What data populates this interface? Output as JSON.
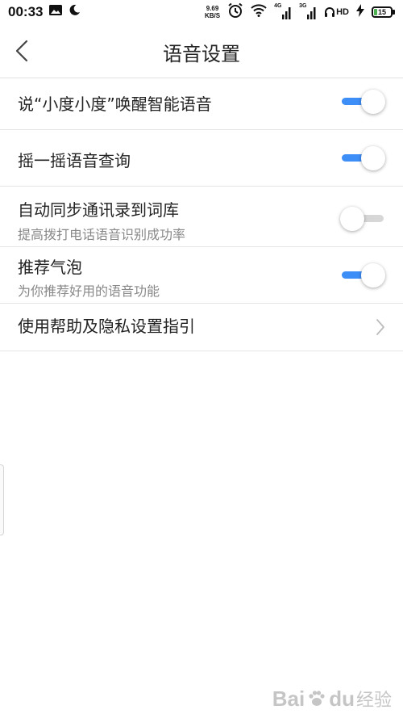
{
  "status_bar": {
    "time": "00:33",
    "net_speed_value": "9.69",
    "net_speed_unit": "KB/S",
    "signal1_label": "4G",
    "signal2_label": "3G",
    "hd_label": "HD",
    "battery_level": "15",
    "icons": [
      "image-icon",
      "moon-icon",
      "alarm-icon",
      "wifi-icon",
      "signal-icon",
      "headphone-icon",
      "charging-icon",
      "battery-icon"
    ]
  },
  "header": {
    "title": "语音设置",
    "back_icon": "chevron-left-icon"
  },
  "settings": {
    "items": [
      {
        "title": "说“小度小度”唤醒智能语音",
        "subtitle": "",
        "control": "toggle",
        "on": true
      },
      {
        "title": "摇一摇语音查询",
        "subtitle": "",
        "control": "toggle",
        "on": true
      },
      {
        "title": "自动同步通讯录到词库",
        "subtitle": "提高拨打电话语音识别成功率",
        "control": "toggle",
        "on": false
      },
      {
        "title": "推荐气泡",
        "subtitle": "为你推荐好用的语音功能",
        "control": "toggle",
        "on": true
      },
      {
        "title": "使用帮助及隐私设置指引",
        "subtitle": "",
        "control": "chevron"
      }
    ]
  },
  "colors": {
    "toggle_on": "#3e8ef7",
    "toggle_off": "#d7d7d7",
    "battery_green": "#4caf50"
  },
  "watermark": {
    "brand": "Bai",
    "brand_suffix": "du",
    "sub": "经验"
  }
}
